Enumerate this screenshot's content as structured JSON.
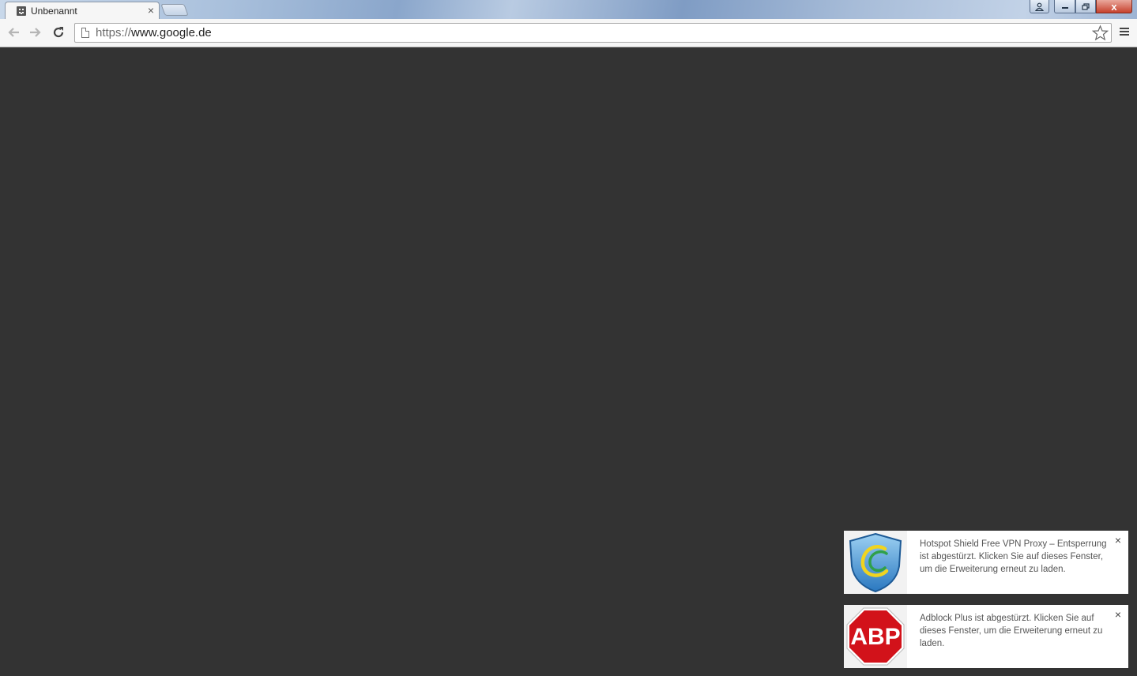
{
  "window": {
    "user_icon": "user-icon",
    "minimize_icon": "minimize-icon",
    "maximize_icon": "maximize-icon",
    "close_label": "x"
  },
  "tab": {
    "title": "Unbenannt",
    "close_label": "×",
    "favicon": "sad-tab-icon"
  },
  "toolbar": {
    "back_icon": "arrow-left-icon",
    "forward_icon": "arrow-right-icon",
    "reload_icon": "reload-icon",
    "url_scheme": "https://",
    "url_host": "www.google.de",
    "star_icon": "star-icon",
    "menu_icon": "hamburger-menu-icon"
  },
  "notifications": [
    {
      "icon": "hotspot-shield-icon",
      "text": "Hotspot Shield Free VPN Proxy – Entsperrung ist abgestürzt. Klicken Sie auf dieses Fenster, um die Erweiterung erneut zu laden.",
      "close_label": "×"
    },
    {
      "icon": "adblock-plus-icon",
      "badge_text": "ABP",
      "text": "Adblock Plus ist abgestürzt. Klicken Sie auf dieses Fenster, um die Erweiterung erneut zu laden.",
      "close_label": "×"
    }
  ],
  "colors": {
    "content_background": "#333333",
    "abp_red": "#d2121a",
    "shield_blue": "#3f8fd0"
  }
}
